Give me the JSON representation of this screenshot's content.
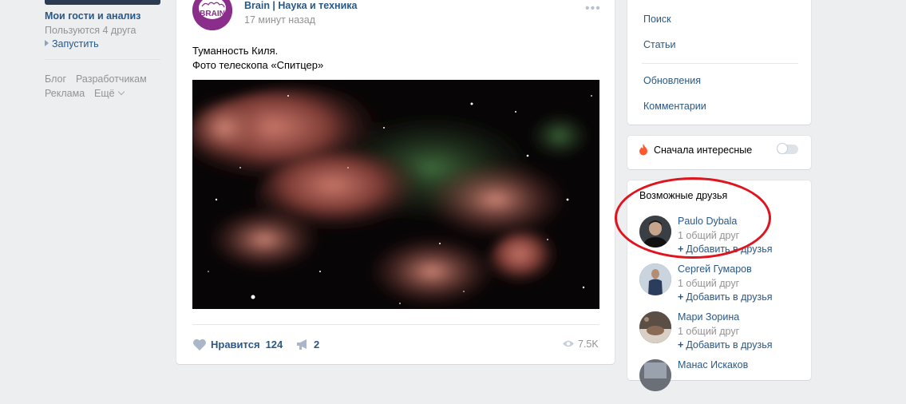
{
  "left_menu": {
    "app_title": "Мои гости и анализ",
    "app_subtitle": "Пользуются 4 друга",
    "app_launch": "Запустить",
    "footer_links": [
      "Блог",
      "Разработчикам",
      "Реклама",
      "Ещё"
    ]
  },
  "post": {
    "author": "Brain | Наука и техника",
    "time": "17 минут назад",
    "avatar_text": "BRAIN",
    "text_line1": "Туманность Киля.",
    "text_line2": "Фото телескопа «Спитцер»",
    "like_label": "Нравится",
    "like_count": "124",
    "share_count": "2",
    "views": "7.5K"
  },
  "right_menu": {
    "items": [
      "Поиск",
      "Статьи",
      "Обновления",
      "Комментарии"
    ]
  },
  "sort": {
    "label": "Сначала интересные",
    "enabled": false
  },
  "friends": {
    "title": "Возможные друзья",
    "list": [
      {
        "name": "Paulo Dybala",
        "common": "1 общий друг",
        "add": "Добавить в друзья"
      },
      {
        "name": "Сергей Гумаров",
        "common": "1 общий друг",
        "add": "Добавить в друзья"
      },
      {
        "name": "Мари Зорина",
        "common": "1 общий друг",
        "add": "Добавить в друзья"
      },
      {
        "name": "Манас Искаков"
      }
    ]
  },
  "colors": {
    "link": "#2a5885",
    "muted": "#939393",
    "page_bg": "#edeef0",
    "annotation_circle": "#e0141e"
  }
}
